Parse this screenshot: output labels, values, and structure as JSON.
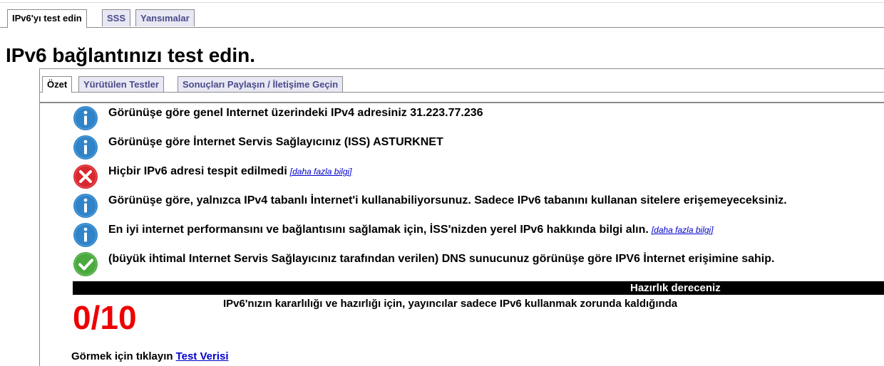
{
  "top_tabs": [
    {
      "label": "IPv6'yı test edin",
      "active": true
    },
    {
      "label": "SSS",
      "active": false
    },
    {
      "label": "Yansımalar",
      "active": false
    }
  ],
  "page_title": "IPv6 bağlantınızı test edin.",
  "inner_tabs": [
    {
      "label": "Özet",
      "active": true
    },
    {
      "label": "Yürütülen Testler",
      "active": false
    },
    {
      "label": "Sonuçları Paylaşın / İletişime Geçin",
      "active": false
    }
  ],
  "results": [
    {
      "icon": "info-icon",
      "text": "Görünüşe göre genel Internet üzerindeki IPv4 adresiniz 31.223.77.236",
      "link": ""
    },
    {
      "icon": "info-icon",
      "text": "Görünüşe göre İnternet Servis Sağlayıcınız (ISS) ASTURKNET",
      "link": ""
    },
    {
      "icon": "error-icon",
      "text": "Hiçbir IPv6 adresi tespit edilmedi",
      "link": "[daha fazla bilgi]"
    },
    {
      "icon": "info-icon",
      "text": "Görünüşe göre, yalnızca IPv4 tabanlı İnternet'i kullanabiliyorsunuz. Sadece IPv6 tabanını kullanan sitelere erişemeyeceksiniz.",
      "link": ""
    },
    {
      "icon": "info-icon",
      "text": "En iyi internet performansını ve bağlantısını sağlamak için, İSS'nizden yerel IPv6 hakkında bilgi alın.",
      "link": "[daha fazla bilgi]"
    },
    {
      "icon": "check-icon",
      "text": "(büyük ihtimal Internet Servis Sağlayıcınız tarafından verilen) DNS sunucunuz görünüşe göre IPV6 İnternet erişimine sahip.",
      "link": ""
    }
  ],
  "score": {
    "bar_label": "Hazırlık dereceniz",
    "value": "0/10",
    "description": "IPv6'nızın kararlılığı ve hazırlığı için, yayıncılar sadece IPv6 kullanmak zorunda kaldığında"
  },
  "footer": {
    "prefix": "Görmek için tıklayın",
    "link": "Test Verisi"
  },
  "colors": {
    "info": "#2f83c8",
    "error": "#d8292f",
    "check": "#4aa93f",
    "score": "#ee0000",
    "link": "#0000cc"
  }
}
